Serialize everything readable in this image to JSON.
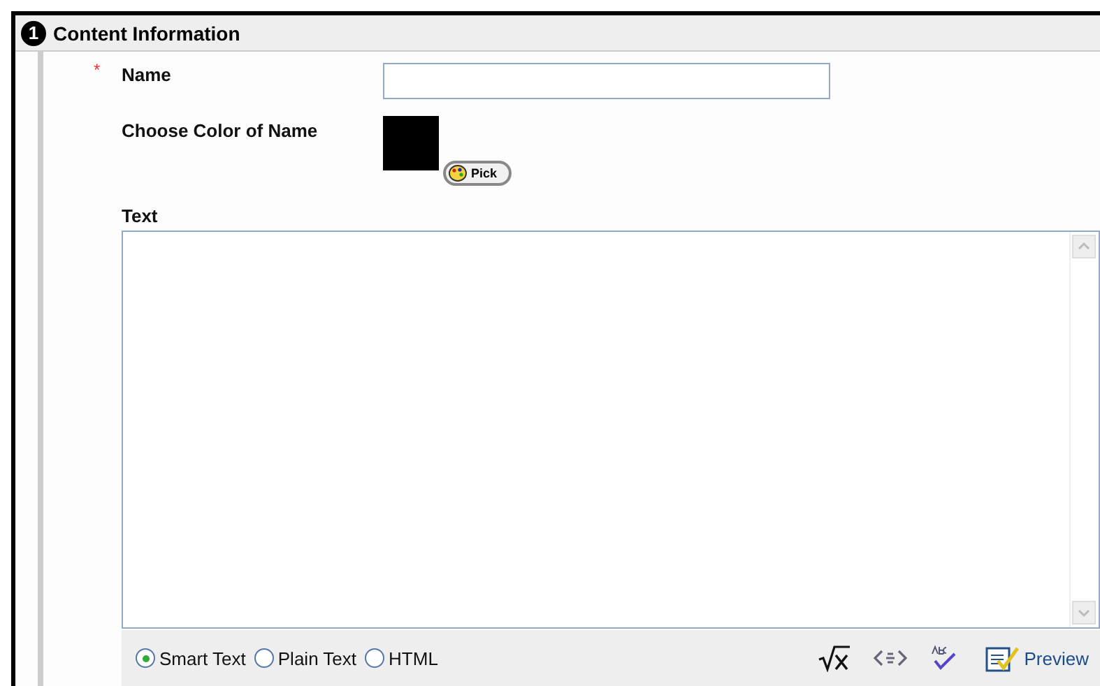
{
  "section": {
    "number": "1",
    "title": "Content Information"
  },
  "fields": [
    {
      "kind": "text",
      "label": "Name",
      "required_mark": "*"
    },
    {
      "kind": "color",
      "label": "Choose Color of Name",
      "color": "#000000",
      "button": "Pick"
    }
  ],
  "text_editor": {
    "label": "Text",
    "formats": [
      {
        "label": "Smart Text",
        "selected": true
      },
      {
        "label": "Plain Text",
        "selected": false
      },
      {
        "label": "HTML",
        "selected": false
      }
    ],
    "preview": "Preview"
  }
}
